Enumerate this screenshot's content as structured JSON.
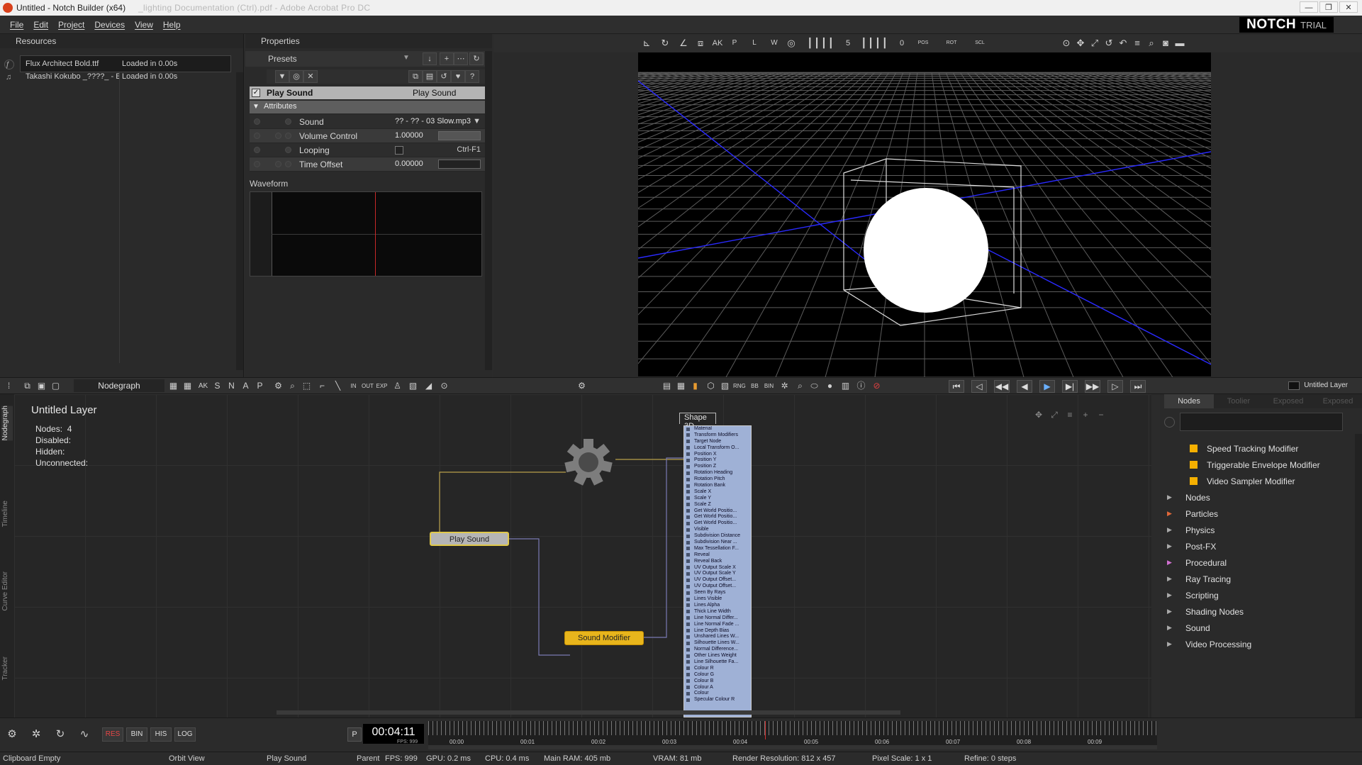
{
  "window": {
    "title": "Untitled - Notch Builder (x64)",
    "blurred_title": "_lighting Documentation (Ctrl).pdf - Adobe Acrobat Pro DC",
    "controls": [
      "—",
      "❐",
      "✕"
    ]
  },
  "menu": {
    "items": [
      "File",
      "Edit",
      "Project",
      "Devices",
      "View",
      "Help"
    ],
    "logo": "NOTCH",
    "logo_suffix": "TRIAL"
  },
  "resources": {
    "title": "Resources",
    "items": [
      {
        "name": "Flux Architect Bold.ttf",
        "status": "Loaded in 0.00s"
      },
      {
        "name": "Takashi Kokubo _????_ - E",
        "status": "Loaded in 0.00s"
      }
    ]
  },
  "properties": {
    "title": "Properties",
    "presets_label": "Presets",
    "node": {
      "name": "Play Sound",
      "type": "Play Sound"
    },
    "attributes_label": "Attributes",
    "attributes": [
      {
        "name": "Sound",
        "value": "?? - ?? - 03 Slow.mp3"
      },
      {
        "name": "Volume Control",
        "value": "1.00000"
      },
      {
        "name": "Looping",
        "value": "",
        "shortcut": "Ctrl-F1"
      },
      {
        "name": "Time Offset",
        "value": "0.00000"
      }
    ],
    "waveform_label": "Waveform"
  },
  "viewport": {
    "toolbar_labels": {
      "ak": "AK",
      "p": "P",
      "l": "L",
      "w": "W",
      "five": "5",
      "zero": "0",
      "pos": "POS",
      "rot": "ROT",
      "scl": "SCL"
    }
  },
  "nodegraph": {
    "title": "Nodegraph",
    "layer_name": "Untitled  Layer",
    "info": [
      {
        "label": "Nodes:",
        "value": "4"
      },
      {
        "label": "Disabled:",
        "value": ""
      },
      {
        "label": "Hidden:",
        "value": ""
      },
      {
        "label": "Unconnected:",
        "value": ""
      }
    ],
    "toolbar_letters": [
      "AK",
      "S",
      "N",
      "A",
      "P"
    ],
    "layer_label": "Untitled Layer",
    "side_tabs": [
      "Nodegraph",
      "Timeline",
      "Curve Editor",
      "Tracker"
    ],
    "nodes": {
      "play_sound": "Play  Sound",
      "sound_modifier": "Sound  Modifier",
      "shape_3d": "Shape  3D"
    },
    "shape_params": [
      "Material",
      "Transform Modifiers",
      "Target Node",
      "Local Transform O...",
      "Position X",
      "Position Y",
      "Position Z",
      "Rotation Heading",
      "Rotation Pitch",
      "Rotation Bank",
      "Scale X",
      "Scale Y",
      "Scale Z",
      "Get World Positio...",
      "Get World Positio...",
      "Get World Positio...",
      "Visible",
      "Subdivision Distance",
      "Subdivision Near ...",
      "Max Tessellation F...",
      "Reveal",
      "Reveal Back",
      "UV Output Scale X",
      "UV Output Scale Y",
      "UV Output Offset...",
      "UV Output Offset...",
      "Seen By Rays",
      "Lines Visible",
      "Lines Alpha",
      "Thick Line Width",
      "Line Normal Differ...",
      "Line Normal Fade ...",
      "Line Depth Bias",
      "Unshared Lines W...",
      "Silhouette Lines W...",
      "Normal Difference...",
      "Other Lines Weight",
      "Line Silhouette Fa...",
      "Colour R",
      "Colour G",
      "Colour B",
      "Colour A",
      "Colour",
      "Specular Colour R"
    ]
  },
  "library": {
    "tabs": [
      "Nodes",
      "Toolier",
      "Exposed",
      "Exposed"
    ],
    "leaf_items": [
      "Speed Tracking Modifier",
      "Triggerable Envelope Modifier",
      "Video Sampler Modifier"
    ],
    "categories": [
      "Nodes",
      "Particles",
      "Physics",
      "Post-FX",
      "Procedural",
      "Ray Tracing",
      "Scripting",
      "Shading Nodes",
      "Sound",
      "Video Processing"
    ]
  },
  "transport": {
    "buttons": [
      "RES",
      "BIN",
      "HIS",
      "LOG"
    ],
    "p_label": "P",
    "timecode": "00:04:11",
    "fps_text": "FPS: 999",
    "timeline_labels": [
      "00:00",
      "00:01",
      "00:02",
      "00:03",
      "00:04",
      "00:05",
      "00:06",
      "00:07",
      "00:08",
      "00:09"
    ],
    "playhead_seconds": 4.45
  },
  "status": {
    "clipboard": "Clipboard Empty",
    "view": "Orbit View",
    "node": "Play Sound",
    "parent": "Parent",
    "fps": "FPS: 999",
    "gpu": "GPU: 0.2 ms",
    "cpu": "CPU: 0.4 ms",
    "ram": "Main RAM: 405 mb",
    "vram": "VRAM: 81 mb",
    "render_res": "Render Resolution: 812 x 457",
    "pixel_scale": "Pixel Scale: 1 x 1",
    "refine": "Refine: 0 steps"
  },
  "colors": {
    "accent_yellow": "#e8b51c",
    "node_grey": "#b5b5b5",
    "shape_blue": "#9fb1d6",
    "playhead_red": "#d23030",
    "grid_blue": "#2a2aff"
  }
}
